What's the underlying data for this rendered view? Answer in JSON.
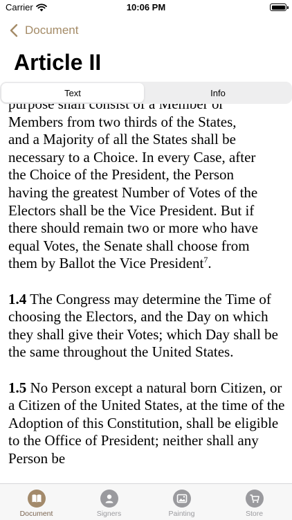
{
  "status": {
    "carrier": "Carrier",
    "time": "10:06 PM"
  },
  "nav": {
    "back_label": "Document"
  },
  "title": "Article II",
  "segments": {
    "text": "Text",
    "info": "Info"
  },
  "doc": {
    "cut_line": "purpose shall consist of a Member or",
    "lines": [
      "Members from two thirds of the States,",
      "and a Majority of all the States shall be",
      "necessary to a Choice. In every Case, after",
      "the Choice of the President, the Person",
      "having the greatest Number of Votes of the",
      "Electors shall be the Vice President. But if",
      "there should remain two or more who have",
      "equal Votes, the Senate shall choose from",
      "them by Ballot the Vice President"
    ],
    "footnote": "7",
    "footnote_after": ".",
    "sec14_num": "1.4",
    "sec14_text": "The Congress may determine the Time of choosing the Electors, and the Day on which they shall give their Votes; which Day shall be the same throughout the United States.",
    "sec15_num": "1.5",
    "sec15_text": "No Person except a natural born Citizen, or a Citizen of the United States, at the time of the Adoption of this Constitution, shall be eligible to the Office of President; neither shall any Person be"
  },
  "tabs": {
    "document": "Document",
    "signers": "Signers",
    "painting": "Painting",
    "store": "Store"
  },
  "colors": {
    "accent": "#a48b67",
    "tab_active_bg": "#a38a6b",
    "tab_inactive_bg": "#9a9a9e"
  }
}
